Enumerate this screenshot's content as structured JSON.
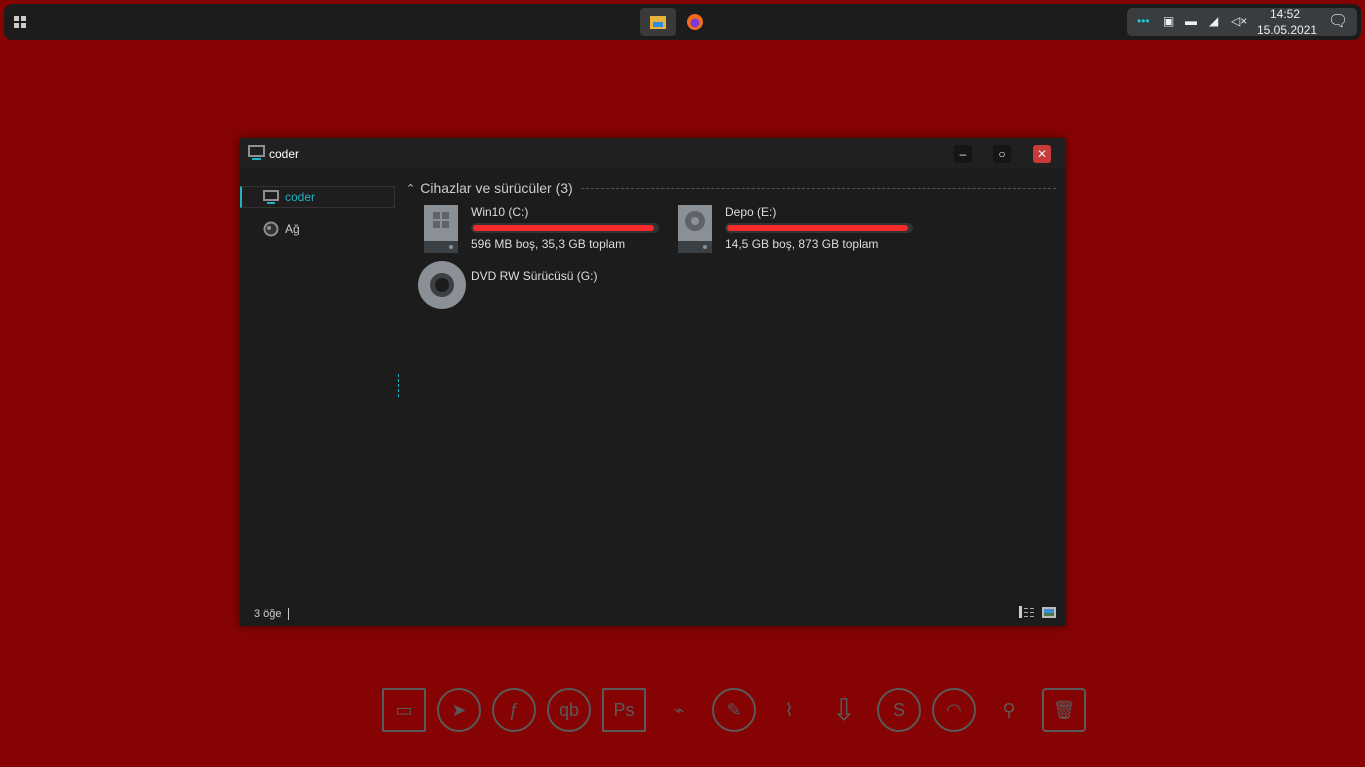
{
  "taskbar": {
    "time": "14:52",
    "date": "15.05.2021",
    "apps": [
      {
        "name": "file-explorer",
        "active": true
      },
      {
        "name": "firefox",
        "active": false
      }
    ]
  },
  "window": {
    "title": "coder",
    "minimize": "–",
    "maximize": "○",
    "close": "✕"
  },
  "sidebar": {
    "items": [
      {
        "label": "coder",
        "selected": true
      },
      {
        "label": "Ağ",
        "selected": false
      }
    ]
  },
  "section": {
    "title": "Cihazlar ve sürücüler (3)"
  },
  "drives": [
    {
      "name": "Win10 (C:)",
      "info": "596 MB boş, 35,3 GB toplam",
      "used_percent": 98.4,
      "icon": "windows-drive-icon"
    },
    {
      "name": "Depo (E:)",
      "info": "14,5 GB boş, 873 GB toplam",
      "used_percent": 98.3,
      "icon": "hard-drive-icon"
    },
    {
      "name": "DVD RW Sürücüsü (G:)",
      "icon": "dvd-drive-icon"
    }
  ],
  "status": {
    "count": "3 öğe"
  },
  "colors": {
    "accent": "#1fb3c2",
    "bar": "#f52a2a",
    "desktop": "#850303"
  },
  "dock": {
    "icons": [
      "monitor",
      "telegram",
      "firefox",
      "qb",
      "Ps",
      "usb",
      "paint",
      "broom",
      "download",
      "skype",
      "alien-headset",
      "search",
      "trash"
    ]
  }
}
